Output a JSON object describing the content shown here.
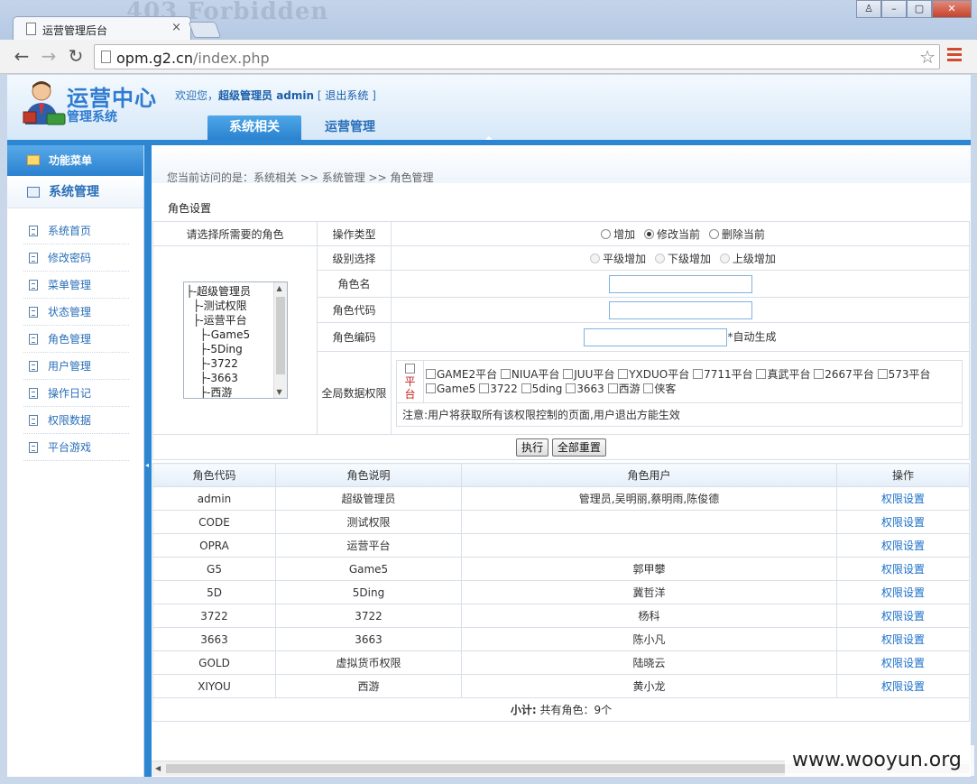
{
  "browser": {
    "ghost_title": "403 Forbidden",
    "tab_title": "运营管理后台",
    "tab_close": "×",
    "window_buttons": [
      "♙",
      "–",
      "▢",
      "✕"
    ],
    "back": "←",
    "forward": "→",
    "reload": "↻",
    "url_host": "opm.g2.cn",
    "url_path": "/index.php",
    "star": "☆"
  },
  "header": {
    "logo_title": "运营中心",
    "logo_sub": "管理系统",
    "welcome_prefix": "欢迎您，",
    "user": "超级管理员 admin",
    "logout_open": "[ ",
    "logout": "退出系统",
    "logout_close": " ]",
    "tabs": [
      {
        "label": "系统相关"
      },
      {
        "label": "运营管理"
      }
    ]
  },
  "sidebar": {
    "head": "功能菜单",
    "group": "系统管理",
    "items": [
      {
        "label": "系统首页"
      },
      {
        "label": "修改密码"
      },
      {
        "label": "菜单管理"
      },
      {
        "label": "状态管理"
      },
      {
        "label": "角色管理"
      },
      {
        "label": "用户管理"
      },
      {
        "label": "操作日记"
      },
      {
        "label": "权限数据"
      },
      {
        "label": "平台游戏"
      }
    ]
  },
  "main": {
    "breadcrumb": "您当前访问的是：系统相关 >> 系统管理 >> 角色管理",
    "section_title": "角色设置",
    "select_role_label": "请选择所需要的角色",
    "tree": [
      "├-超级管理员",
      "  ├-测试权限",
      "  ├-运营平台",
      "    ├-Game5",
      "    ├-5Ding",
      "    ├-3722",
      "    ├-3663",
      "    ├-西游"
    ],
    "op_type_label": "操作类型",
    "op_types": [
      "增加",
      "修改当前",
      "删除当前"
    ],
    "level_label": "级别选择",
    "levels": [
      "平级增加",
      "下级增加",
      "上级增加"
    ],
    "role_name_label": "角色名",
    "role_code_label": "角色代码",
    "role_no_label": "角色编码",
    "auto_gen": "*自动生成",
    "global_perm_label": "全局数据权限",
    "platform_label": "平台",
    "platforms_row1": [
      "GAME2平台",
      "NIUA平台",
      "JUU平台",
      "YXDUO平台",
      "7711平台",
      "真武平台",
      "2667平台",
      "573平台"
    ],
    "platforms_row2": [
      "Game5",
      "3722",
      "5ding",
      "3663",
      "西游",
      "侠客"
    ],
    "notice": "注意:用户将获取所有该权限控制的页面,用户退出方能生效",
    "execute_btn": "执行",
    "reset_btn": "全部重置",
    "columns": [
      "角色代码",
      "角色说明",
      "角色用户",
      "操作"
    ],
    "rows": [
      {
        "code": "admin",
        "desc": "超级管理员",
        "users": "管理员,吴明丽,蔡明雨,陈俊德",
        "op": "权限设置"
      },
      {
        "code": "CODE",
        "desc": "测试权限",
        "users": "",
        "op": "权限设置"
      },
      {
        "code": "OPRA",
        "desc": "运营平台",
        "users": "",
        "op": "权限设置"
      },
      {
        "code": "G5",
        "desc": "Game5",
        "users": "郭甲攀",
        "op": "权限设置"
      },
      {
        "code": "5D",
        "desc": "5Ding",
        "users": "冀哲洋",
        "op": "权限设置"
      },
      {
        "code": "3722",
        "desc": "3722",
        "users": "杨科",
        "op": "权限设置"
      },
      {
        "code": "3663",
        "desc": "3663",
        "users": "陈小凡",
        "op": "权限设置"
      },
      {
        "code": "GOLD",
        "desc": "虚拟货币权限",
        "users": "陆晓云",
        "op": "权限设置"
      },
      {
        "code": "XIYOU",
        "desc": "西游",
        "users": "黄小龙",
        "op": "权限设置"
      }
    ],
    "summary_label": "小计:",
    "summary_text": "共有角色：9个"
  },
  "watermark": "www.wooyun.org"
}
